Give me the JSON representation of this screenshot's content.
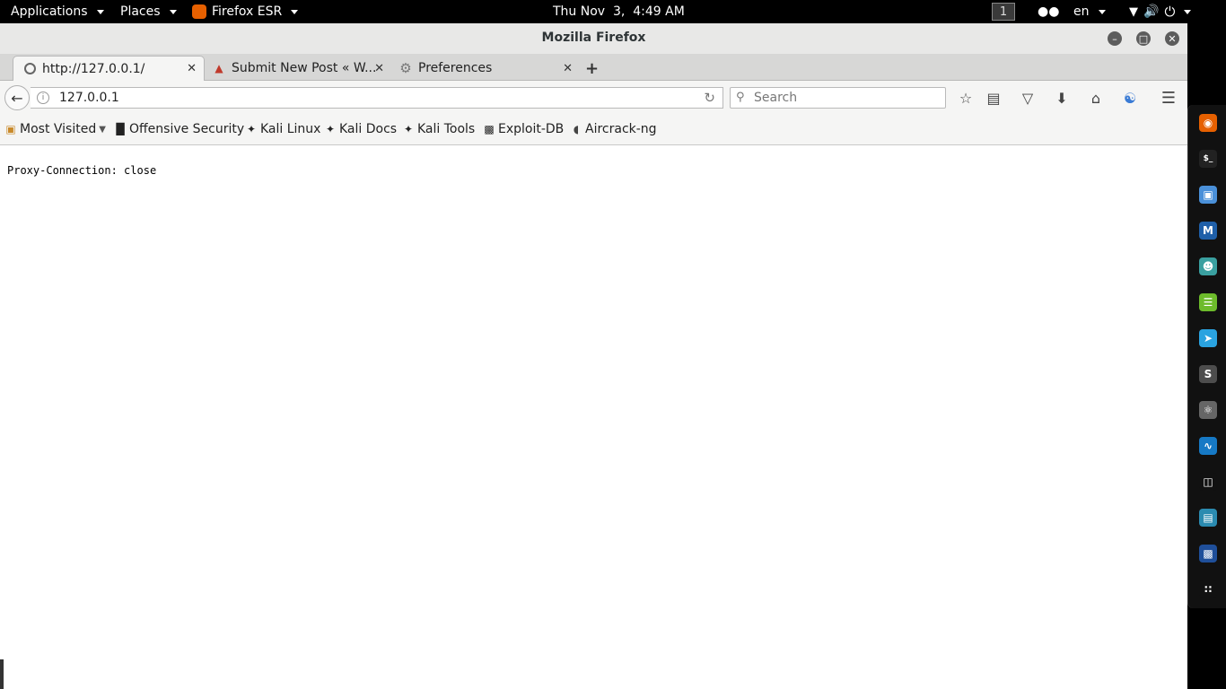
{
  "topbar": {
    "applications": "Applications",
    "places": "Places",
    "app_menu": "Firefox ESR",
    "clock": "Thu Nov  3,  4:49 AM",
    "workspace": "1",
    "language": "en"
  },
  "window": {
    "title": "Mozilla Firefox"
  },
  "tabs": [
    {
      "label": "http://127.0.0.1/",
      "icon": "page-icon",
      "active": true
    },
    {
      "label": "Submit New Post « W...",
      "icon": "flame-icon",
      "active": false
    },
    {
      "label": "Preferences",
      "icon": "gear-icon",
      "active": false
    }
  ],
  "navbar": {
    "url": "127.0.0.1",
    "search_placeholder": "Search"
  },
  "bookmarks": [
    {
      "label": "Most Visited",
      "icon": "folder-icon",
      "dropdown": true
    },
    {
      "label": "Offensive Security",
      "icon": "offsec-icon"
    },
    {
      "label": "Kali Linux",
      "icon": "kali-icon"
    },
    {
      "label": "Kali Docs",
      "icon": "kali-icon"
    },
    {
      "label": "Kali Tools",
      "icon": "kali-icon"
    },
    {
      "label": "Exploit-DB",
      "icon": "exploitdb-icon"
    },
    {
      "label": "Aircrack-ng",
      "icon": "aircrack-icon"
    }
  ],
  "content": {
    "text": "Proxy-Connection: close"
  },
  "dock": [
    {
      "name": "firefox-icon",
      "color": "#e66000"
    },
    {
      "name": "terminal-icon",
      "color": "#222222"
    },
    {
      "name": "files-icon",
      "color": "#4a90d9"
    },
    {
      "name": "metasploit-icon",
      "color": "#1f5fa8"
    },
    {
      "name": "armitage-icon",
      "color": "#3aa0a0"
    },
    {
      "name": "notes-icon",
      "color": "#6dbb2b"
    },
    {
      "name": "telegram-icon",
      "color": "#2aa3e0"
    },
    {
      "name": "sublime-icon",
      "color": "#4d4d4d"
    },
    {
      "name": "atom-icon",
      "color": "#666666"
    },
    {
      "name": "wireshark-icon",
      "color": "#1679c5"
    },
    {
      "name": "trash-icon",
      "color": "#111111"
    },
    {
      "name": "monitor-icon",
      "color": "#2b8bb0"
    },
    {
      "name": "vbox-icon",
      "color": "#1f4f9a"
    },
    {
      "name": "app-grid-icon",
      "color": "#111111"
    }
  ]
}
